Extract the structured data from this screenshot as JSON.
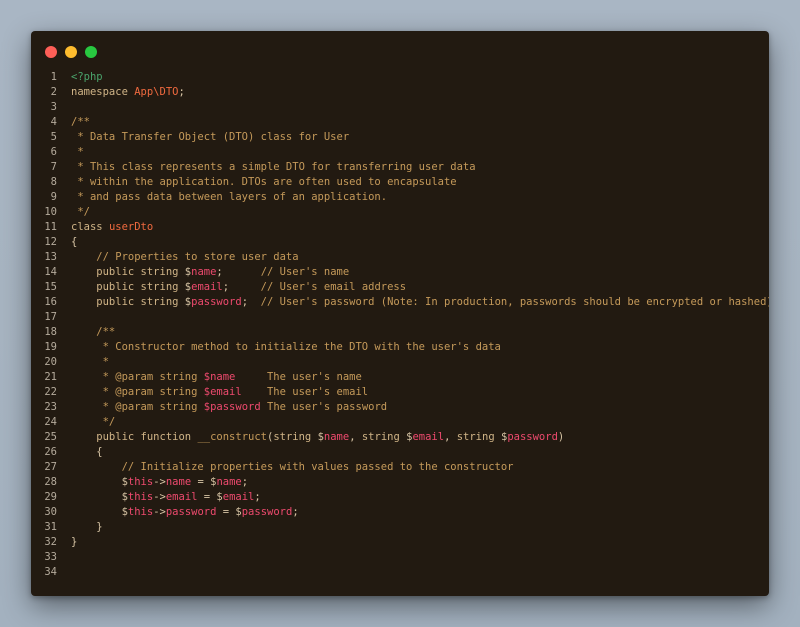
{
  "window": {
    "controls": {
      "close_color": "#fe5f57",
      "minimize_color": "#febc2e",
      "maximize_color": "#28c840"
    }
  },
  "editor": {
    "language": "php",
    "lines": [
      {
        "number": "1",
        "tokens": [
          {
            "t": "tag",
            "v": "<?php"
          }
        ]
      },
      {
        "number": "2",
        "tokens": [
          {
            "t": "kw",
            "v": "namespace "
          },
          {
            "t": "ns",
            "v": "App\\DTO"
          },
          {
            "t": "plain",
            "v": ";"
          }
        ]
      },
      {
        "number": "3",
        "tokens": []
      },
      {
        "number": "4",
        "tokens": [
          {
            "t": "cm",
            "v": "/**"
          }
        ]
      },
      {
        "number": "5",
        "tokens": [
          {
            "t": "cm",
            "v": " * Data Transfer Object (DTO) class for User"
          }
        ]
      },
      {
        "number": "6",
        "tokens": [
          {
            "t": "cm",
            "v": " *"
          }
        ]
      },
      {
        "number": "7",
        "tokens": [
          {
            "t": "cm",
            "v": " * This class represents a simple DTO for transferring user data"
          }
        ]
      },
      {
        "number": "8",
        "tokens": [
          {
            "t": "cm",
            "v": " * within the application. DTOs are often used to encapsulate"
          }
        ]
      },
      {
        "number": "9",
        "tokens": [
          {
            "t": "cm",
            "v": " * and pass data between layers of an application."
          }
        ]
      },
      {
        "number": "10",
        "tokens": [
          {
            "t": "cm",
            "v": " */"
          }
        ]
      },
      {
        "number": "11",
        "tokens": [
          {
            "t": "kw",
            "v": "class "
          },
          {
            "t": "cls",
            "v": "userDto"
          }
        ]
      },
      {
        "number": "12",
        "tokens": [
          {
            "t": "plain",
            "v": "{"
          }
        ]
      },
      {
        "number": "13",
        "tokens": [
          {
            "t": "cm",
            "v": "    // Properties to store user data"
          }
        ]
      },
      {
        "number": "14",
        "tokens": [
          {
            "t": "kw",
            "v": "    public string "
          },
          {
            "t": "plain",
            "v": "$"
          },
          {
            "t": "var",
            "v": "name"
          },
          {
            "t": "plain",
            "v": ";      "
          },
          {
            "t": "cm",
            "v": "// User's name"
          }
        ]
      },
      {
        "number": "15",
        "tokens": [
          {
            "t": "kw",
            "v": "    public string "
          },
          {
            "t": "plain",
            "v": "$"
          },
          {
            "t": "var",
            "v": "email"
          },
          {
            "t": "plain",
            "v": ";     "
          },
          {
            "t": "cm",
            "v": "// User's email address"
          }
        ]
      },
      {
        "number": "16",
        "tokens": [
          {
            "t": "kw",
            "v": "    public string "
          },
          {
            "t": "plain",
            "v": "$"
          },
          {
            "t": "var",
            "v": "password"
          },
          {
            "t": "plain",
            "v": ";  "
          },
          {
            "t": "cm",
            "v": "// User's password (Note: In production, passwords should be encrypted or hashed)"
          }
        ]
      },
      {
        "number": "17",
        "tokens": []
      },
      {
        "number": "18",
        "tokens": [
          {
            "t": "cm",
            "v": "    /**"
          }
        ]
      },
      {
        "number": "19",
        "tokens": [
          {
            "t": "cm",
            "v": "     * Constructor method to initialize the DTO with the user's data"
          }
        ]
      },
      {
        "number": "20",
        "tokens": [
          {
            "t": "cm",
            "v": "     *"
          }
        ]
      },
      {
        "number": "21",
        "tokens": [
          {
            "t": "cm",
            "v": "     * @param string "
          },
          {
            "t": "var",
            "v": "$name"
          },
          {
            "t": "cm",
            "v": "     The user's name"
          }
        ]
      },
      {
        "number": "22",
        "tokens": [
          {
            "t": "cm",
            "v": "     * @param string "
          },
          {
            "t": "var",
            "v": "$email"
          },
          {
            "t": "cm",
            "v": "    The user's email"
          }
        ]
      },
      {
        "number": "23",
        "tokens": [
          {
            "t": "cm",
            "v": "     * @param string "
          },
          {
            "t": "var",
            "v": "$password"
          },
          {
            "t": "cm",
            "v": " The user's password"
          }
        ]
      },
      {
        "number": "24",
        "tokens": [
          {
            "t": "cm",
            "v": "     */"
          }
        ]
      },
      {
        "number": "25",
        "tokens": [
          {
            "t": "kw",
            "v": "    public function "
          },
          {
            "t": "fn",
            "v": "__construct"
          },
          {
            "t": "plain",
            "v": "("
          },
          {
            "t": "kw",
            "v": "string "
          },
          {
            "t": "plain",
            "v": "$"
          },
          {
            "t": "var",
            "v": "name"
          },
          {
            "t": "plain",
            "v": ", "
          },
          {
            "t": "kw",
            "v": "string "
          },
          {
            "t": "plain",
            "v": "$"
          },
          {
            "t": "var",
            "v": "email"
          },
          {
            "t": "plain",
            "v": ", "
          },
          {
            "t": "kw",
            "v": "string "
          },
          {
            "t": "plain",
            "v": "$"
          },
          {
            "t": "var",
            "v": "password"
          },
          {
            "t": "plain",
            "v": ")"
          }
        ]
      },
      {
        "number": "26",
        "tokens": [
          {
            "t": "plain",
            "v": "    {"
          }
        ]
      },
      {
        "number": "27",
        "tokens": [
          {
            "t": "cm",
            "v": "        // Initialize properties with values passed to the constructor"
          }
        ]
      },
      {
        "number": "28",
        "tokens": [
          {
            "t": "plain",
            "v": "        $"
          },
          {
            "t": "var",
            "v": "this"
          },
          {
            "t": "plain",
            "v": "->"
          },
          {
            "t": "var",
            "v": "name"
          },
          {
            "t": "plain",
            "v": " = $"
          },
          {
            "t": "var",
            "v": "name"
          },
          {
            "t": "plain",
            "v": ";"
          }
        ]
      },
      {
        "number": "29",
        "tokens": [
          {
            "t": "plain",
            "v": "        $"
          },
          {
            "t": "var",
            "v": "this"
          },
          {
            "t": "plain",
            "v": "->"
          },
          {
            "t": "var",
            "v": "email"
          },
          {
            "t": "plain",
            "v": " = $"
          },
          {
            "t": "var",
            "v": "email"
          },
          {
            "t": "plain",
            "v": ";"
          }
        ]
      },
      {
        "number": "30",
        "tokens": [
          {
            "t": "plain",
            "v": "        $"
          },
          {
            "t": "var",
            "v": "this"
          },
          {
            "t": "plain",
            "v": "->"
          },
          {
            "t": "var",
            "v": "password"
          },
          {
            "t": "plain",
            "v": " = $"
          },
          {
            "t": "var",
            "v": "password"
          },
          {
            "t": "plain",
            "v": ";"
          }
        ]
      },
      {
        "number": "31",
        "tokens": [
          {
            "t": "plain",
            "v": "    }"
          }
        ]
      },
      {
        "number": "32",
        "tokens": [
          {
            "t": "plain",
            "v": "}"
          }
        ]
      },
      {
        "number": "33",
        "tokens": []
      },
      {
        "number": "34",
        "tokens": []
      }
    ]
  }
}
